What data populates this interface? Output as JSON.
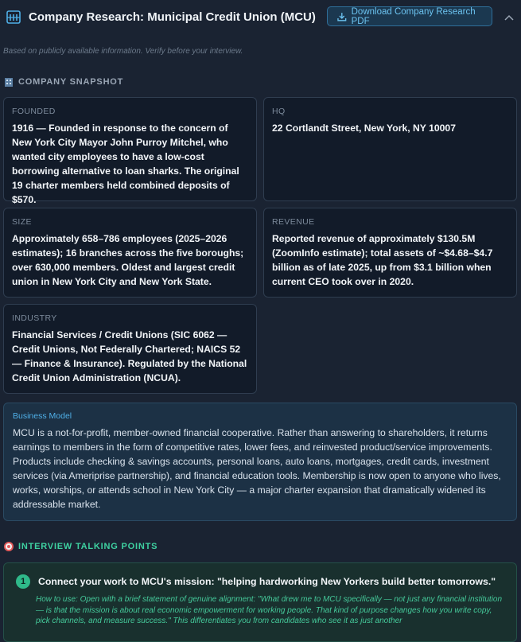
{
  "header": {
    "title": "Company Research: Municipal Credit Union (MCU)",
    "download_label": "Download Company Research PDF",
    "icons": {
      "doc": "document-icon",
      "download": "download-icon",
      "collapse": "chevron-up-icon"
    }
  },
  "disclaimer": "Based on publicly available information. Verify before your interview.",
  "snapshot": {
    "title": "COMPANY SNAPSHOT",
    "icon": "building-icon",
    "cards": [
      {
        "label": "FOUNDED",
        "value": "1916 — Founded in response to the concern of New York City Mayor John Purroy Mitchel, who wanted city employees to have a low-cost borrowing alternative to loan sharks. The original 19 charter members held combined deposits of $570."
      },
      {
        "label": "HQ",
        "value": "22 Cortlandt Street, New York, NY 10007"
      },
      {
        "label": "SIZE",
        "value": "Approximately 658–786 employees (2025–2026 estimates); 16 branches across the five boroughs; over 630,000 members. Oldest and largest credit union in New York City and New York State."
      },
      {
        "label": "REVENUE",
        "value": "Reported revenue of approximately $130.5M (ZoomInfo estimate); total assets of ~$4.68–$4.7 billion as of late 2025, up from $3.1 billion when current CEO took over in 2020."
      },
      {
        "label": "INDUSTRY",
        "value": "Financial Services / Credit Unions (SIC 6062 — Credit Unions, Not Federally Chartered; NAICS 52 — Finance & Insurance). Regulated by the National Credit Union Administration (NCUA)."
      }
    ]
  },
  "business_model": {
    "label": "Business Model",
    "text": "MCU is a not-for-profit, member-owned financial cooperative. Rather than answering to shareholders, it returns earnings to members in the form of competitive rates, lower fees, and reinvested product/service improvements. Products include checking & savings accounts, personal loans, auto loans, mortgages, credit cards, investment services (via Ameriprise partnership), and financial education tools. Membership is now open to anyone who lives, works, worships, or attends school in New York City — a major charter expansion that dramatically widened its addressable market."
  },
  "talking_points": {
    "title": "INTERVIEW TALKING POINTS",
    "icon": "target-icon",
    "items": [
      {
        "number": "1",
        "heading": "Connect your work to MCU's mission: \"helping hardworking New Yorkers build better tomorrows.\"",
        "how_to": "How to use: Open with a brief statement of genuine alignment: \"What drew me to MCU specifically — not just any financial institution — is that the mission is about real economic empowerment for working people. That kind of purpose changes how you write copy, pick channels, and measure success.\" This differentiates you from candidates who see it as just another"
      }
    ]
  },
  "colors": {
    "background": "#1a2332",
    "accent_blue": "#4fb0e8",
    "accent_green": "#3ed1a1"
  }
}
